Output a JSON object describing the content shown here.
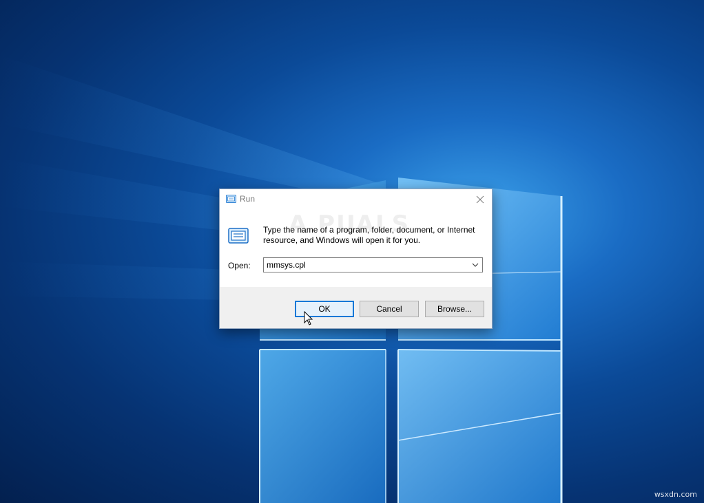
{
  "dialog": {
    "title": "Run",
    "title_icon": "run-app-icon",
    "close_icon": "close-icon",
    "description": "Type the name of a program, folder, document, or Internet resource, and Windows will open it for you.",
    "watermark": "A PUALS",
    "open_label": "Open:",
    "open_value": "mmsys.cpl",
    "dropdown_icon": "chevron-down-icon"
  },
  "buttons": {
    "ok": "OK",
    "cancel": "Cancel",
    "browse": "Browse..."
  },
  "site_watermark": "wsxdn.com",
  "colors": {
    "accent": "#0078d7",
    "footer": "#f0f0f0",
    "desktop_dark": "#03204f",
    "desktop_light": "#3a9ee8"
  }
}
